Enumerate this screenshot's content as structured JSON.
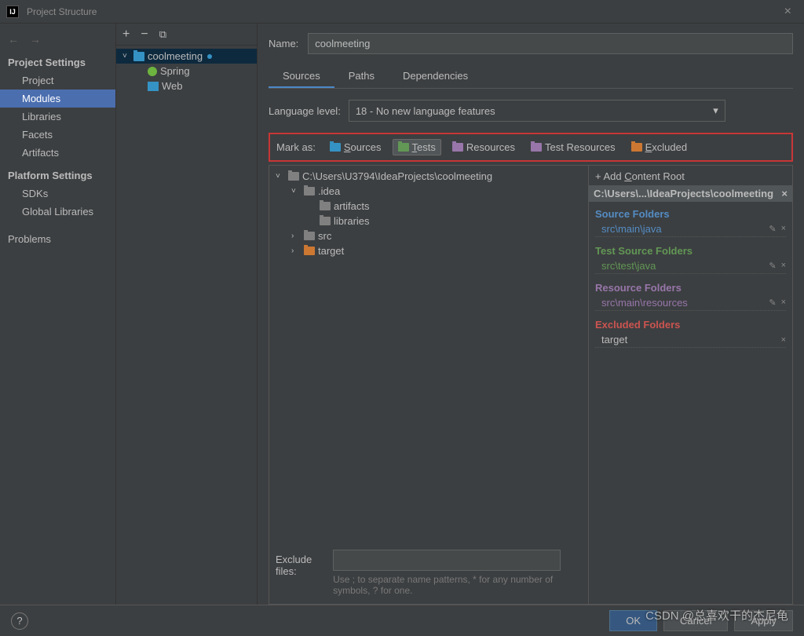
{
  "window": {
    "title": "Project Structure"
  },
  "nav": {
    "sections": {
      "project_settings": "Project Settings",
      "platform_settings": "Platform Settings"
    },
    "items": {
      "project": "Project",
      "modules": "Modules",
      "libraries": "Libraries",
      "facets": "Facets",
      "artifacts": "Artifacts",
      "sdks": "SDKs",
      "global_libs": "Global Libraries",
      "problems": "Problems"
    }
  },
  "modules_tree": {
    "root": "coolmeeting",
    "children": {
      "spring": "Spring",
      "web": "Web"
    }
  },
  "detail": {
    "name_label": "Name:",
    "name_value": "coolmeeting",
    "tabs": {
      "sources": "Sources",
      "paths": "Paths",
      "deps": "Dependencies"
    },
    "lang_label": "Language level:",
    "lang_value": "18 - No new language features",
    "mark_label": "Mark as:",
    "mark": {
      "sources": "Sources",
      "tests": "Tests",
      "resources": "Resources",
      "test_resources": "Test Resources",
      "excluded": "Excluded"
    },
    "dir_tree": {
      "root": "C:\\Users\\U3794\\IdeaProjects\\coolmeeting",
      "idea": ".idea",
      "artifacts": "artifacts",
      "libraries": "libraries",
      "src": "src",
      "target": "target"
    },
    "roots": {
      "add": "Add Content Root",
      "path": "C:\\Users\\...\\IdeaProjects\\coolmeeting",
      "source_folders": "Source Folders",
      "source_item": "src\\main\\java",
      "test_folders": "Test Source Folders",
      "test_item": "src\\test\\java",
      "resource_folders": "Resource Folders",
      "resource_item": "src\\main\\resources",
      "excluded_folders": "Excluded Folders",
      "excluded_item": "target"
    },
    "exclude_label": "Exclude files:",
    "exclude_hint": "Use ; to separate name patterns, * for any number of symbols, ? for one."
  },
  "buttons": {
    "ok": "OK",
    "cancel": "Cancel",
    "apply": "Apply"
  },
  "watermark": "CSDN @总喜欢干的杰尼龟"
}
